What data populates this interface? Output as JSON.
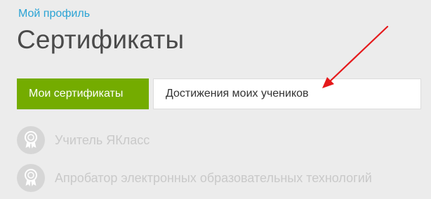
{
  "breadcrumb": {
    "label": "Мой профиль"
  },
  "page": {
    "title": "Сертификаты"
  },
  "tabs": [
    {
      "label": "Мои сертификаты",
      "active": true
    },
    {
      "label": "Достижения моих учеников",
      "active": false
    }
  ],
  "certificates": [
    {
      "label": "Учитель ЯКласс",
      "icon": "medal-icon"
    },
    {
      "label": "Апробатор электронных образовательных технологий",
      "icon": "medal-icon"
    }
  ],
  "annotation": {
    "icon": "red-arrow-icon",
    "color": "#e5191b"
  },
  "colors": {
    "accent_green": "#74ac00",
    "link_blue": "#2aa3d4",
    "title_gray": "#4a4a4a",
    "disabled_text": "#c9c9c9",
    "background": "#ececec"
  }
}
